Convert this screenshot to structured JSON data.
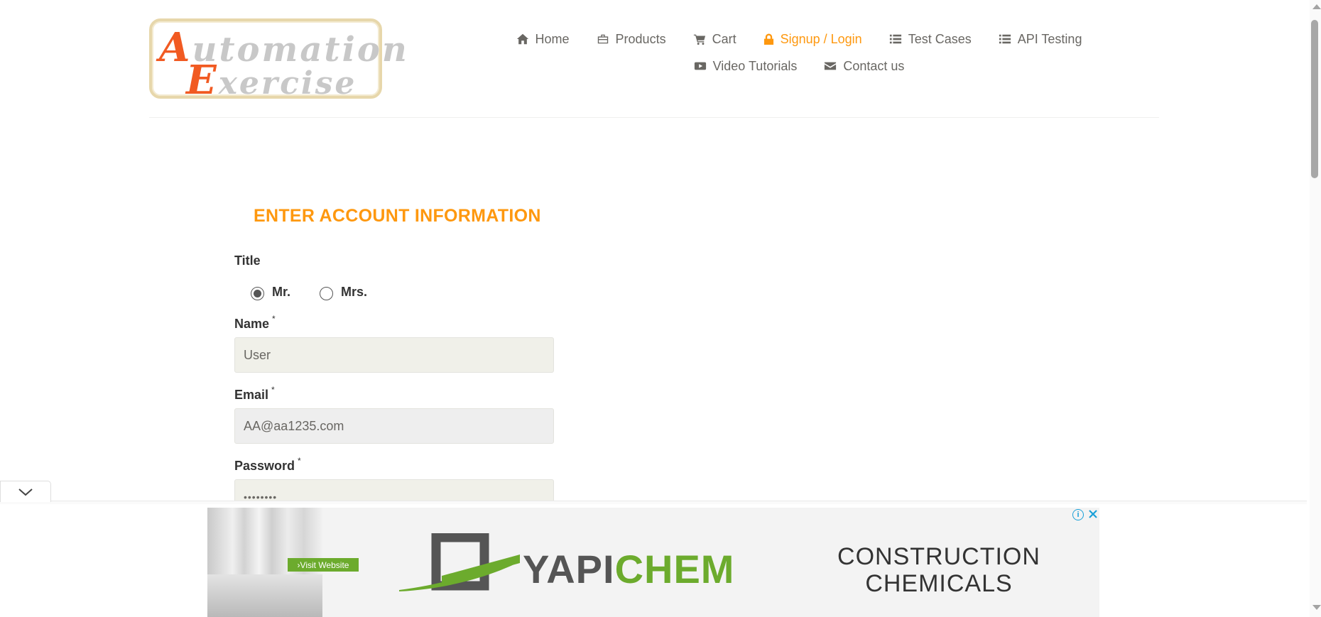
{
  "logo": {
    "line1_cap": "A",
    "line1_rest": "utomation",
    "line2_cap": "E",
    "line2_rest": "xercise"
  },
  "nav": {
    "row1": [
      {
        "label": "Home",
        "icon": "home-icon"
      },
      {
        "label": "Products",
        "icon": "briefcase-icon"
      },
      {
        "label": "Cart",
        "icon": "cart-icon"
      },
      {
        "label": "Signup / Login",
        "icon": "lock-icon",
        "active": true
      },
      {
        "label": "Test Cases",
        "icon": "list-icon"
      },
      {
        "label": "API Testing",
        "icon": "list-icon"
      }
    ],
    "row2": [
      {
        "label": "Video Tutorials",
        "icon": "youtube-icon"
      },
      {
        "label": "Contact us",
        "icon": "envelope-icon"
      }
    ]
  },
  "form": {
    "title": "ENTER ACCOUNT INFORMATION",
    "title_label": "Title",
    "title_options": [
      {
        "label": "Mr.",
        "checked": true
      },
      {
        "label": "Mrs.",
        "checked": false
      }
    ],
    "name_label": "Name",
    "name_value": "User",
    "email_label": "Email",
    "email_value": "AA@aa1235.com",
    "password_label": "Password",
    "password_value": "••••••••",
    "required_mark": "*"
  },
  "ad": {
    "visit_label": "›Visit Website",
    "brand_part1": "YAPI",
    "brand_part2": "CHEM",
    "tagline_line1": "CONSTRUCTION",
    "tagline_line2": "CHEMICALS",
    "info_label": "i",
    "brand_green": "#6cab2d",
    "brand_gray": "#555555"
  },
  "colors": {
    "accent": "#fe980f",
    "text": "#696763"
  }
}
